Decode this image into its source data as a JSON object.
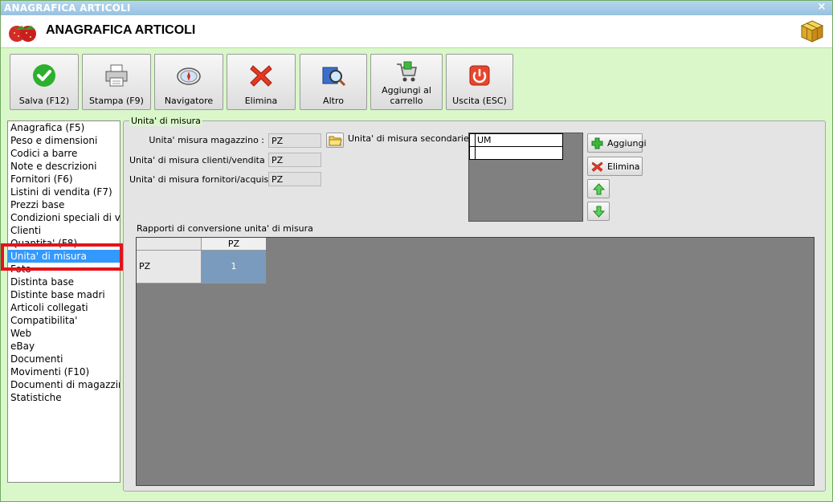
{
  "window": {
    "titlebar_text": "ANAGRAFICA ARTICOLI",
    "close_glyph": "×"
  },
  "header": {
    "title": "ANAGRAFICA ARTICOLI"
  },
  "toolbar": {
    "buttons": [
      {
        "label": "Salva (F12)",
        "icon": "check-icon"
      },
      {
        "label": "Stampa (F9)",
        "icon": "printer-icon"
      },
      {
        "label": "Navigatore",
        "icon": "compass-icon"
      },
      {
        "label": "Elimina",
        "icon": "delete-x-icon"
      },
      {
        "label": "Altro",
        "icon": "search-book-icon"
      },
      {
        "label": "Aggiungi al carrello",
        "icon": "cart-icon"
      },
      {
        "label": "Uscita (ESC)",
        "icon": "power-icon"
      }
    ]
  },
  "nav": {
    "items": [
      "Anagrafica (F5)",
      "Peso e dimensioni",
      "Codici a barre",
      "Note e descrizioni",
      "Fornitori (F6)",
      "Listini di vendita (F7)",
      "Prezzi base",
      "Condizioni speciali di ve",
      "Clienti",
      "Quantita' (F8)",
      "Unita' di misura",
      "Foto",
      "Distinta base",
      "Distinte base madri",
      "Articoli collegati",
      "Compatibilita'",
      "Web",
      "eBay",
      "Documenti",
      "Movimenti (F10)",
      "Documenti di magazzino",
      "Statistiche"
    ],
    "selected": "Unita' di misura"
  },
  "panel": {
    "group_title": "Unita' di misura",
    "magazzino_label": "Unita' misura magazzino :",
    "magazzino_value": "PZ",
    "clienti_label": "Unita' di misura clienti/vendita :",
    "clienti_value": "PZ",
    "fornitori_label": "Unita' di misura fornitori/acquisto :",
    "fornitori_value": "PZ",
    "secondarie_label": "Unita' di misura secondarie :",
    "secondarie_header": "UM",
    "aggiungi_label": "Aggiungi",
    "elimina_label": "Elimina",
    "conversion_label": "Rapporti di conversione unita' di misura",
    "conversion": {
      "column_header": "PZ",
      "row_header": "PZ",
      "value": "1"
    }
  },
  "colors": {
    "window_bg": "#d9f7c8",
    "selected_nav": "#3399ff",
    "highlight_box": "#e4131a",
    "grid_bg": "#808080",
    "cell_selected": "#7a9bbd"
  }
}
